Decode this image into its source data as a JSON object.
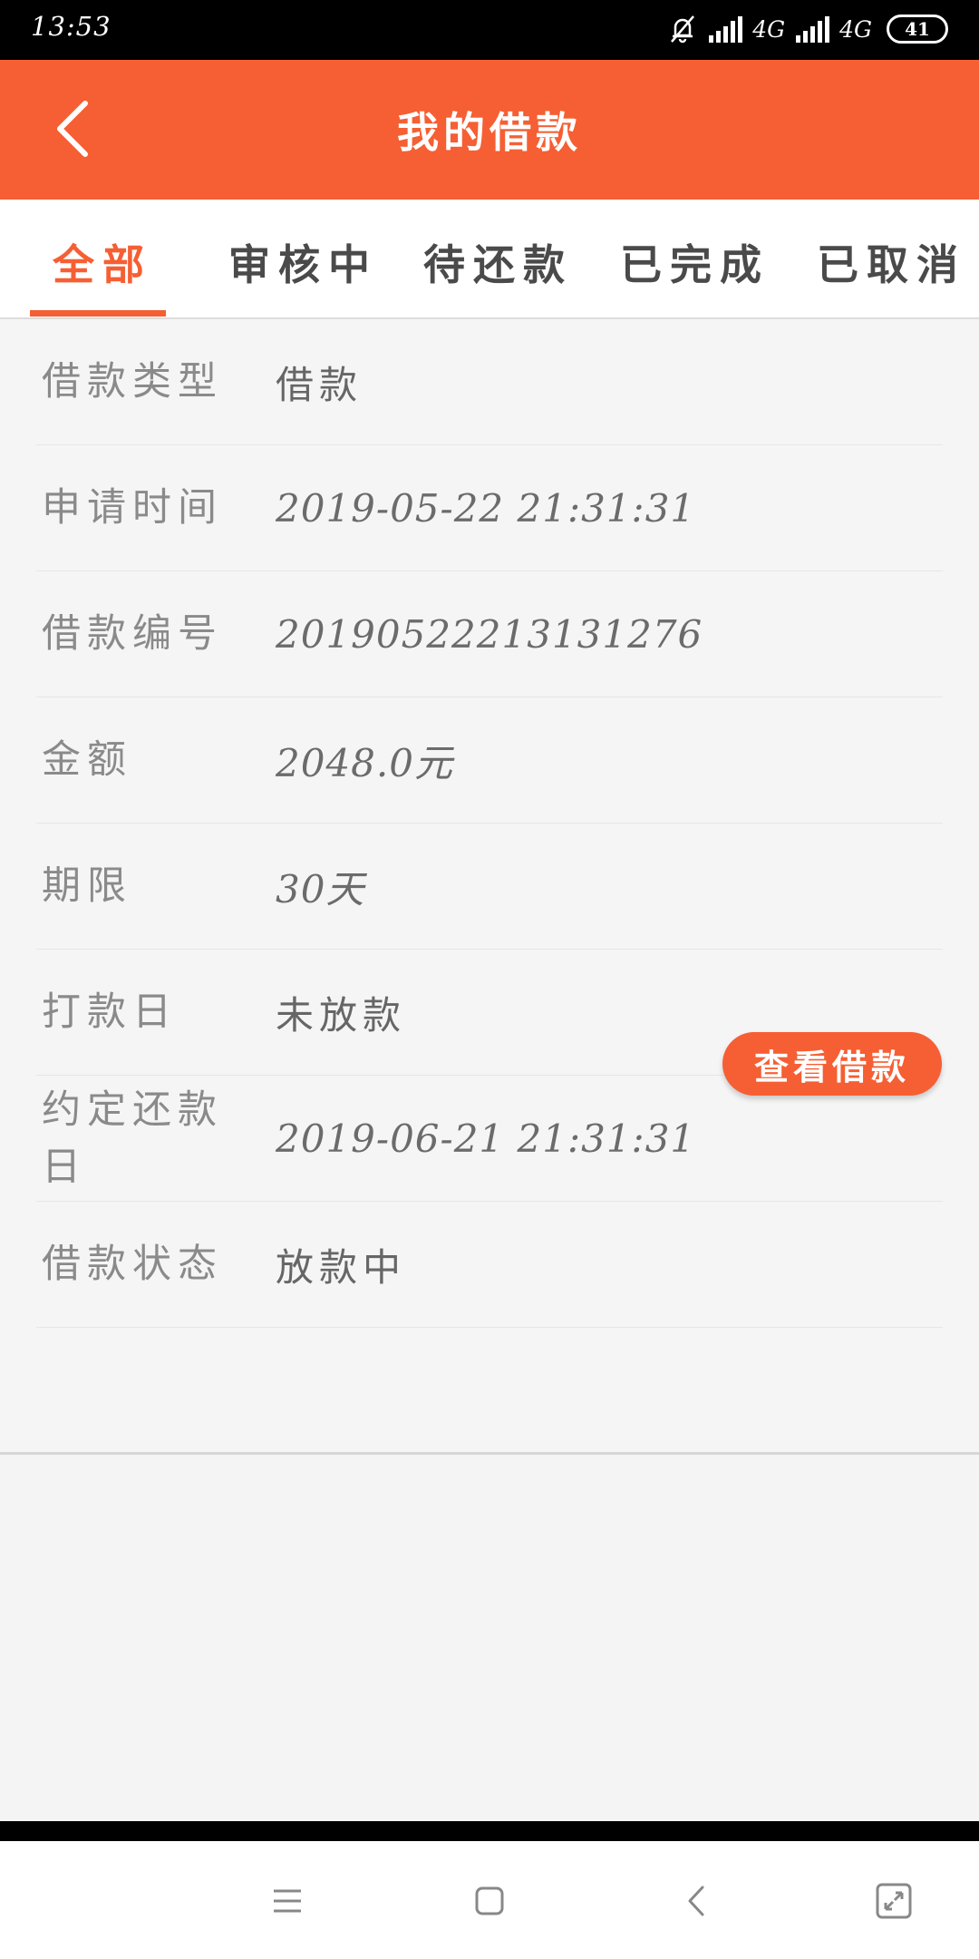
{
  "status_bar": {
    "time": "13:53",
    "network_1": "4G",
    "network_2": "4G",
    "battery": "41"
  },
  "header": {
    "title": "我的借款",
    "back_icon": "chevron-left-icon"
  },
  "tabs": [
    {
      "label": "全部",
      "active": true
    },
    {
      "label": "审核中",
      "active": false
    },
    {
      "label": "待还款",
      "active": false
    },
    {
      "label": "已完成",
      "active": false
    },
    {
      "label": "已取消",
      "active": false
    }
  ],
  "loan": {
    "rows": [
      {
        "label": "借款类型",
        "value": "借款"
      },
      {
        "label": "申请时间",
        "value": "2019-05-22 21:31:31"
      },
      {
        "label": "借款编号",
        "value": "20190522213131276"
      },
      {
        "label": "金额",
        "value": "2048.0元"
      },
      {
        "label": "期限",
        "value": "30天"
      },
      {
        "label": "打款日",
        "value": "未放款"
      },
      {
        "label": "约定还款日",
        "value": "2019-06-21 21:31:31"
      },
      {
        "label": "借款状态",
        "value": "放款中"
      }
    ],
    "view_button": "查看借款"
  },
  "colors": {
    "accent": "#f55f33",
    "label": "#8a8a8a",
    "value": "#6b6b6b"
  }
}
